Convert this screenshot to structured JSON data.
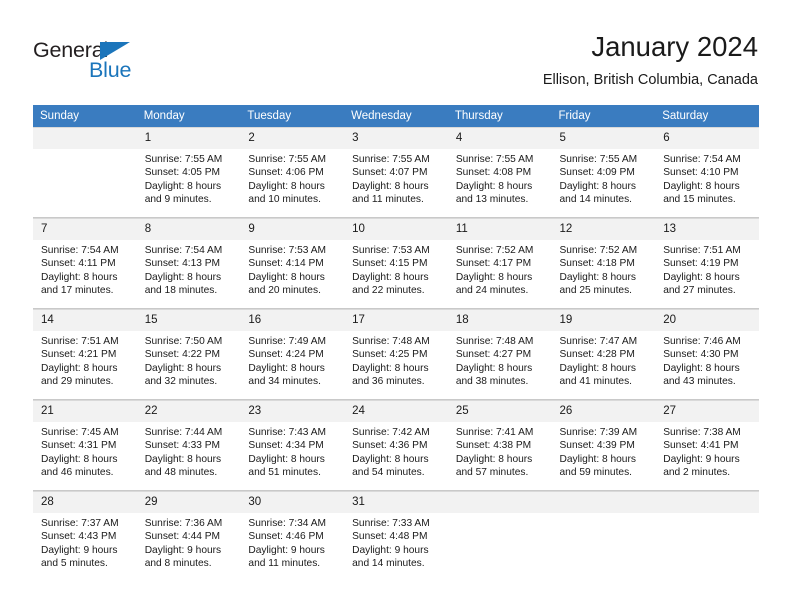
{
  "brand": {
    "name_part1": "General",
    "name_part2": "Blue",
    "accent_color": "#1b75bb"
  },
  "header": {
    "title": "January 2024",
    "subtitle": "Ellison, British Columbia, Canada",
    "header_bg_color": "#3a7cc0"
  },
  "weekday_headers": [
    "Sunday",
    "Monday",
    "Tuesday",
    "Wednesday",
    "Thursday",
    "Friday",
    "Saturday"
  ],
  "weeks": [
    [
      {
        "day": "",
        "lines": []
      },
      {
        "day": "1",
        "lines": [
          "Sunrise: 7:55 AM",
          "Sunset: 4:05 PM",
          "Daylight: 8 hours",
          "and 9 minutes."
        ]
      },
      {
        "day": "2",
        "lines": [
          "Sunrise: 7:55 AM",
          "Sunset: 4:06 PM",
          "Daylight: 8 hours",
          "and 10 minutes."
        ]
      },
      {
        "day": "3",
        "lines": [
          "Sunrise: 7:55 AM",
          "Sunset: 4:07 PM",
          "Daylight: 8 hours",
          "and 11 minutes."
        ]
      },
      {
        "day": "4",
        "lines": [
          "Sunrise: 7:55 AM",
          "Sunset: 4:08 PM",
          "Daylight: 8 hours",
          "and 13 minutes."
        ]
      },
      {
        "day": "5",
        "lines": [
          "Sunrise: 7:55 AM",
          "Sunset: 4:09 PM",
          "Daylight: 8 hours",
          "and 14 minutes."
        ]
      },
      {
        "day": "6",
        "lines": [
          "Sunrise: 7:54 AM",
          "Sunset: 4:10 PM",
          "Daylight: 8 hours",
          "and 15 minutes."
        ]
      }
    ],
    [
      {
        "day": "7",
        "lines": [
          "Sunrise: 7:54 AM",
          "Sunset: 4:11 PM",
          "Daylight: 8 hours",
          "and 17 minutes."
        ]
      },
      {
        "day": "8",
        "lines": [
          "Sunrise: 7:54 AM",
          "Sunset: 4:13 PM",
          "Daylight: 8 hours",
          "and 18 minutes."
        ]
      },
      {
        "day": "9",
        "lines": [
          "Sunrise: 7:53 AM",
          "Sunset: 4:14 PM",
          "Daylight: 8 hours",
          "and 20 minutes."
        ]
      },
      {
        "day": "10",
        "lines": [
          "Sunrise: 7:53 AM",
          "Sunset: 4:15 PM",
          "Daylight: 8 hours",
          "and 22 minutes."
        ]
      },
      {
        "day": "11",
        "lines": [
          "Sunrise: 7:52 AM",
          "Sunset: 4:17 PM",
          "Daylight: 8 hours",
          "and 24 minutes."
        ]
      },
      {
        "day": "12",
        "lines": [
          "Sunrise: 7:52 AM",
          "Sunset: 4:18 PM",
          "Daylight: 8 hours",
          "and 25 minutes."
        ]
      },
      {
        "day": "13",
        "lines": [
          "Sunrise: 7:51 AM",
          "Sunset: 4:19 PM",
          "Daylight: 8 hours",
          "and 27 minutes."
        ]
      }
    ],
    [
      {
        "day": "14",
        "lines": [
          "Sunrise: 7:51 AM",
          "Sunset: 4:21 PM",
          "Daylight: 8 hours",
          "and 29 minutes."
        ]
      },
      {
        "day": "15",
        "lines": [
          "Sunrise: 7:50 AM",
          "Sunset: 4:22 PM",
          "Daylight: 8 hours",
          "and 32 minutes."
        ]
      },
      {
        "day": "16",
        "lines": [
          "Sunrise: 7:49 AM",
          "Sunset: 4:24 PM",
          "Daylight: 8 hours",
          "and 34 minutes."
        ]
      },
      {
        "day": "17",
        "lines": [
          "Sunrise: 7:48 AM",
          "Sunset: 4:25 PM",
          "Daylight: 8 hours",
          "and 36 minutes."
        ]
      },
      {
        "day": "18",
        "lines": [
          "Sunrise: 7:48 AM",
          "Sunset: 4:27 PM",
          "Daylight: 8 hours",
          "and 38 minutes."
        ]
      },
      {
        "day": "19",
        "lines": [
          "Sunrise: 7:47 AM",
          "Sunset: 4:28 PM",
          "Daylight: 8 hours",
          "and 41 minutes."
        ]
      },
      {
        "day": "20",
        "lines": [
          "Sunrise: 7:46 AM",
          "Sunset: 4:30 PM",
          "Daylight: 8 hours",
          "and 43 minutes."
        ]
      }
    ],
    [
      {
        "day": "21",
        "lines": [
          "Sunrise: 7:45 AM",
          "Sunset: 4:31 PM",
          "Daylight: 8 hours",
          "and 46 minutes."
        ]
      },
      {
        "day": "22",
        "lines": [
          "Sunrise: 7:44 AM",
          "Sunset: 4:33 PM",
          "Daylight: 8 hours",
          "and 48 minutes."
        ]
      },
      {
        "day": "23",
        "lines": [
          "Sunrise: 7:43 AM",
          "Sunset: 4:34 PM",
          "Daylight: 8 hours",
          "and 51 minutes."
        ]
      },
      {
        "day": "24",
        "lines": [
          "Sunrise: 7:42 AM",
          "Sunset: 4:36 PM",
          "Daylight: 8 hours",
          "and 54 minutes."
        ]
      },
      {
        "day": "25",
        "lines": [
          "Sunrise: 7:41 AM",
          "Sunset: 4:38 PM",
          "Daylight: 8 hours",
          "and 57 minutes."
        ]
      },
      {
        "day": "26",
        "lines": [
          "Sunrise: 7:39 AM",
          "Sunset: 4:39 PM",
          "Daylight: 8 hours",
          "and 59 minutes."
        ]
      },
      {
        "day": "27",
        "lines": [
          "Sunrise: 7:38 AM",
          "Sunset: 4:41 PM",
          "Daylight: 9 hours",
          "and 2 minutes."
        ]
      }
    ],
    [
      {
        "day": "28",
        "lines": [
          "Sunrise: 7:37 AM",
          "Sunset: 4:43 PM",
          "Daylight: 9 hours",
          "and 5 minutes."
        ]
      },
      {
        "day": "29",
        "lines": [
          "Sunrise: 7:36 AM",
          "Sunset: 4:44 PM",
          "Daylight: 9 hours",
          "and 8 minutes."
        ]
      },
      {
        "day": "30",
        "lines": [
          "Sunrise: 7:34 AM",
          "Sunset: 4:46 PM",
          "Daylight: 9 hours",
          "and 11 minutes."
        ]
      },
      {
        "day": "31",
        "lines": [
          "Sunrise: 7:33 AM",
          "Sunset: 4:48 PM",
          "Daylight: 9 hours",
          "and 14 minutes."
        ]
      },
      {
        "day": "",
        "lines": []
      },
      {
        "day": "",
        "lines": []
      },
      {
        "day": "",
        "lines": []
      }
    ]
  ]
}
